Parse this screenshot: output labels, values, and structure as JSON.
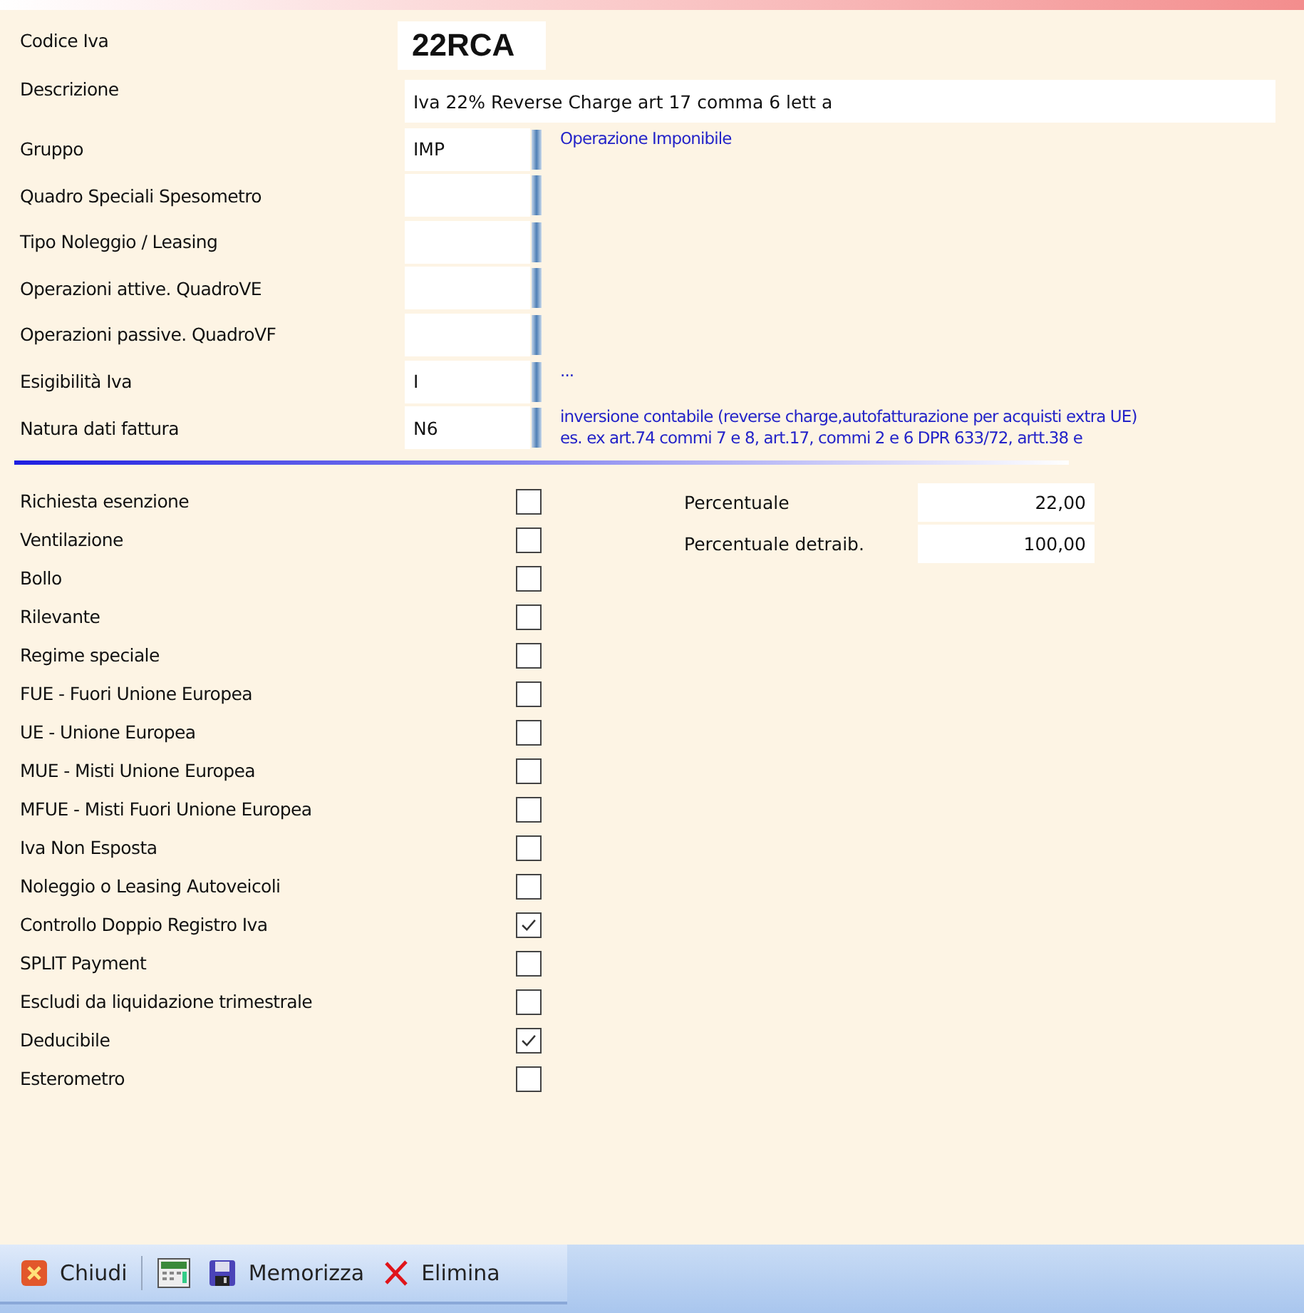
{
  "codice": {
    "label": "Codice Iva",
    "value": "22RCA"
  },
  "descrizione": {
    "label": "Descrizione",
    "value": "Iva 22% Reverse Charge art 17 comma 6 lett a"
  },
  "lookups": [
    {
      "label": "Gruppo",
      "value": "IMP",
      "description": "Operazione Imponibile"
    },
    {
      "label": "Quadro Speciali Spesometro"
    },
    {
      "label": "Tipo Noleggio / Leasing"
    },
    {
      "label": "Operazioni attive. QuadroVE"
    },
    {
      "label": "Operazioni passive. QuadroVF"
    },
    {
      "label": "Esigibilità Iva",
      "value": "I",
      "description": "..."
    },
    {
      "label": "Natura dati fattura",
      "value": "N6",
      "description": "inversione contabile (reverse charge,autofatturazione per acquisti extra UE) es. ex art.74 commi 7 e 8, art.17, commi 2 e 6 DPR 633/72, artt.38 e"
    }
  ],
  "checks": [
    {
      "label": "Richiesta esenzione",
      "checked": false
    },
    {
      "label": "Ventilazione",
      "checked": false
    },
    {
      "label": "Bollo",
      "checked": false
    },
    {
      "label": "Rilevante",
      "checked": false
    },
    {
      "label": "Regime speciale",
      "checked": false
    },
    {
      "label": "FUE - Fuori Unione Europea",
      "checked": false
    },
    {
      "label": "UE - Unione Europea",
      "checked": false
    },
    {
      "label": "MUE - Misti Unione Europea",
      "checked": false
    },
    {
      "label": "MFUE - Misti Fuori Unione Europea",
      "checked": false
    },
    {
      "label": "Iva Non Esposta",
      "checked": false
    },
    {
      "label": "Noleggio o Leasing Autoveicoli",
      "checked": false
    },
    {
      "label": "Controllo Doppio Registro Iva",
      "checked": true
    },
    {
      "label": "SPLIT Payment",
      "checked": false
    },
    {
      "label": "Escludi da liquidazione trimestrale",
      "checked": false
    },
    {
      "label": "Deducibile",
      "checked": true
    },
    {
      "label": "Esterometro",
      "checked": false
    }
  ],
  "percentages": [
    {
      "label": "Percentuale",
      "value": "22,00"
    },
    {
      "label": "Percentuale detraib.",
      "value": "100,00"
    }
  ],
  "toolbar": [
    {
      "kind": "close",
      "label": "Chiudi"
    },
    {
      "kind": "calculator"
    },
    {
      "kind": "save",
      "label": "Memorizza"
    },
    {
      "kind": "delete",
      "label": "Elimina"
    }
  ]
}
